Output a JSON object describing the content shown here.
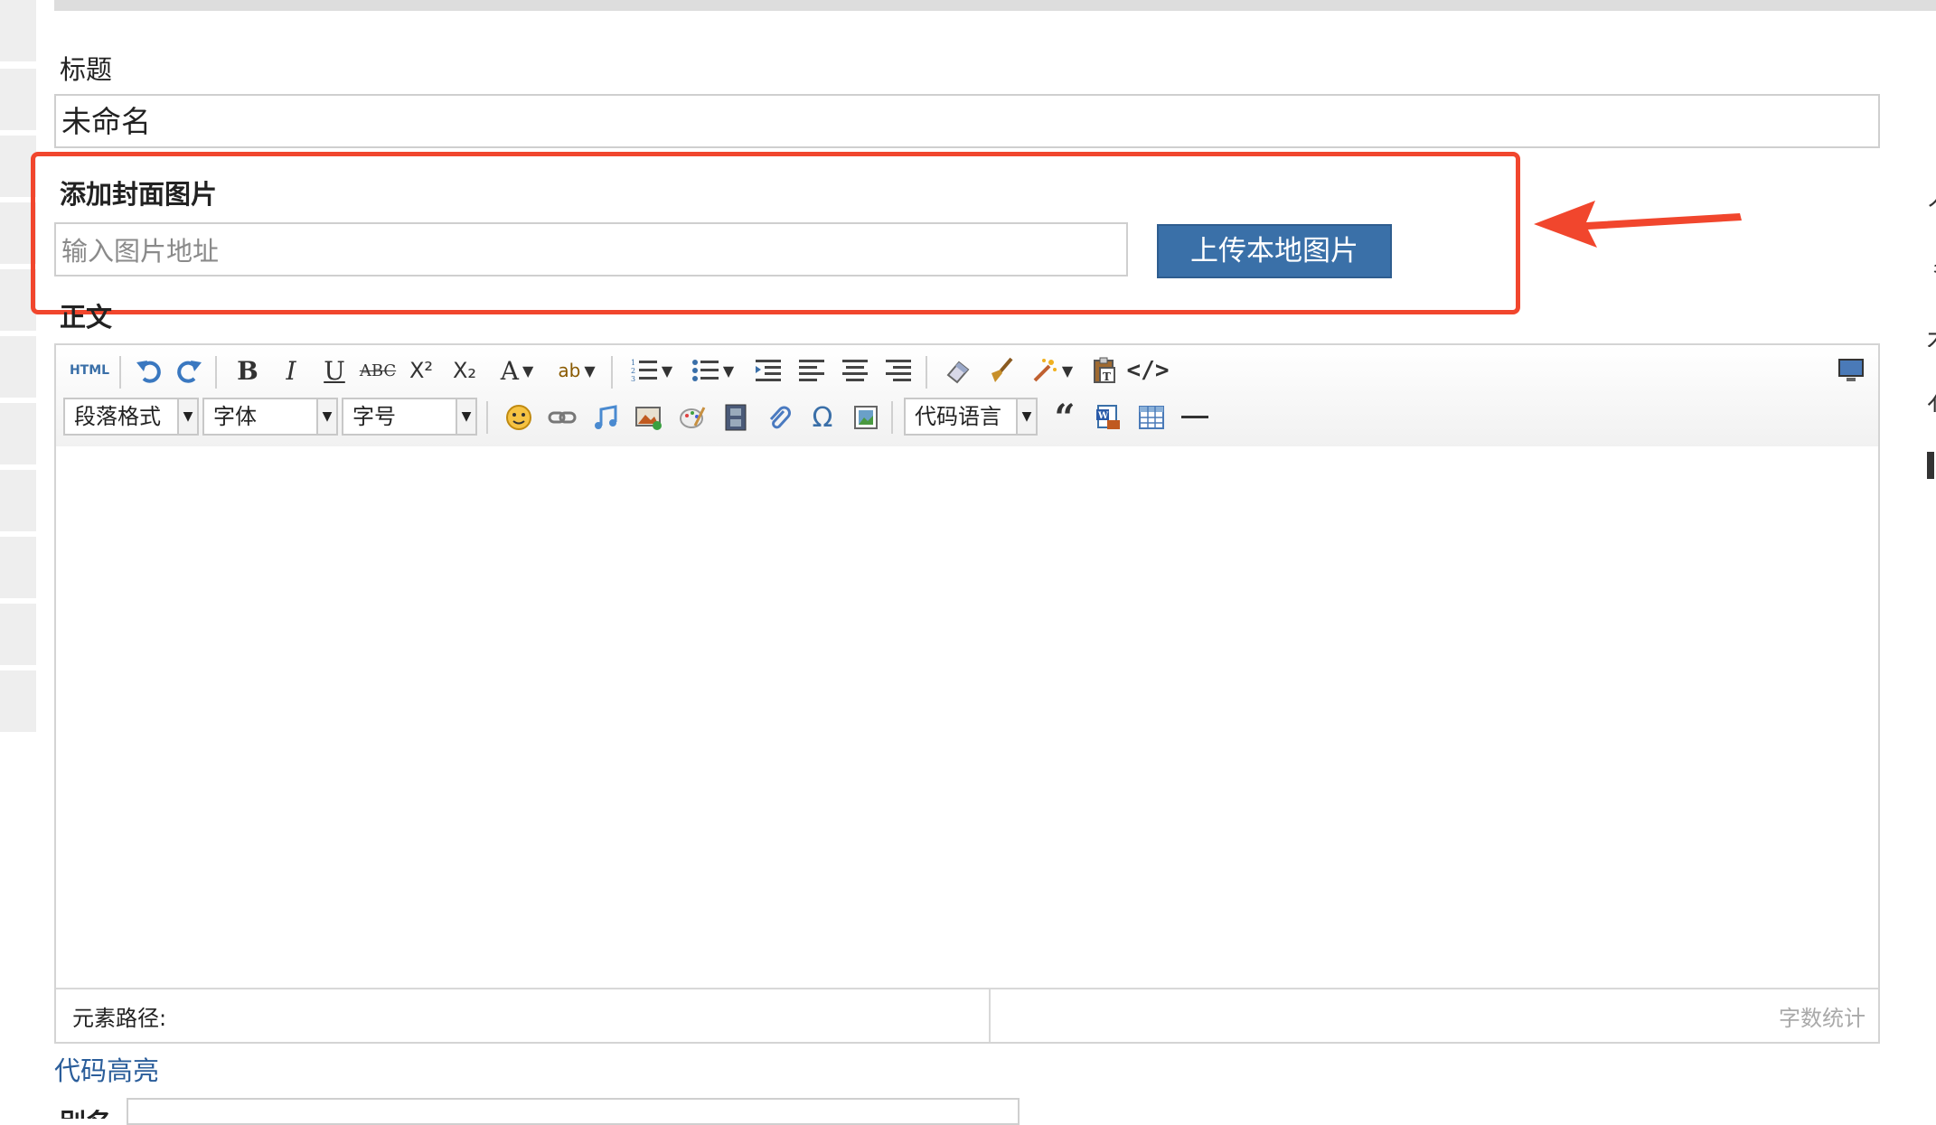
{
  "form": {
    "title_label": "标题",
    "title_value": "未命名",
    "cover_label": "添加封面图片",
    "cover_placeholder": "输入图片地址",
    "upload_button": "上传本地图片",
    "body_label": "正文",
    "code_highlight_link": "代码高亮",
    "alias_label": "别名"
  },
  "editor": {
    "toolbar_row1": {
      "html_label": "HTML",
      "bold": "B",
      "italic": "I",
      "underline": "U",
      "strikethrough": "ABC",
      "superscript": "X²",
      "subscript": "X₂",
      "font_color": "A",
      "highlight": "ab"
    },
    "toolbar_row2": {
      "paragraph_format": "段落格式",
      "font_family": "字体",
      "font_size": "字号",
      "code_language": "代码语言"
    },
    "status": {
      "element_path_label": "元素路径:",
      "word_count_label": "字数统计"
    }
  },
  "colors": {
    "highlight_border": "#f1462d",
    "upload_button_bg": "#3a70a8",
    "link": "#2a5d9a"
  }
}
